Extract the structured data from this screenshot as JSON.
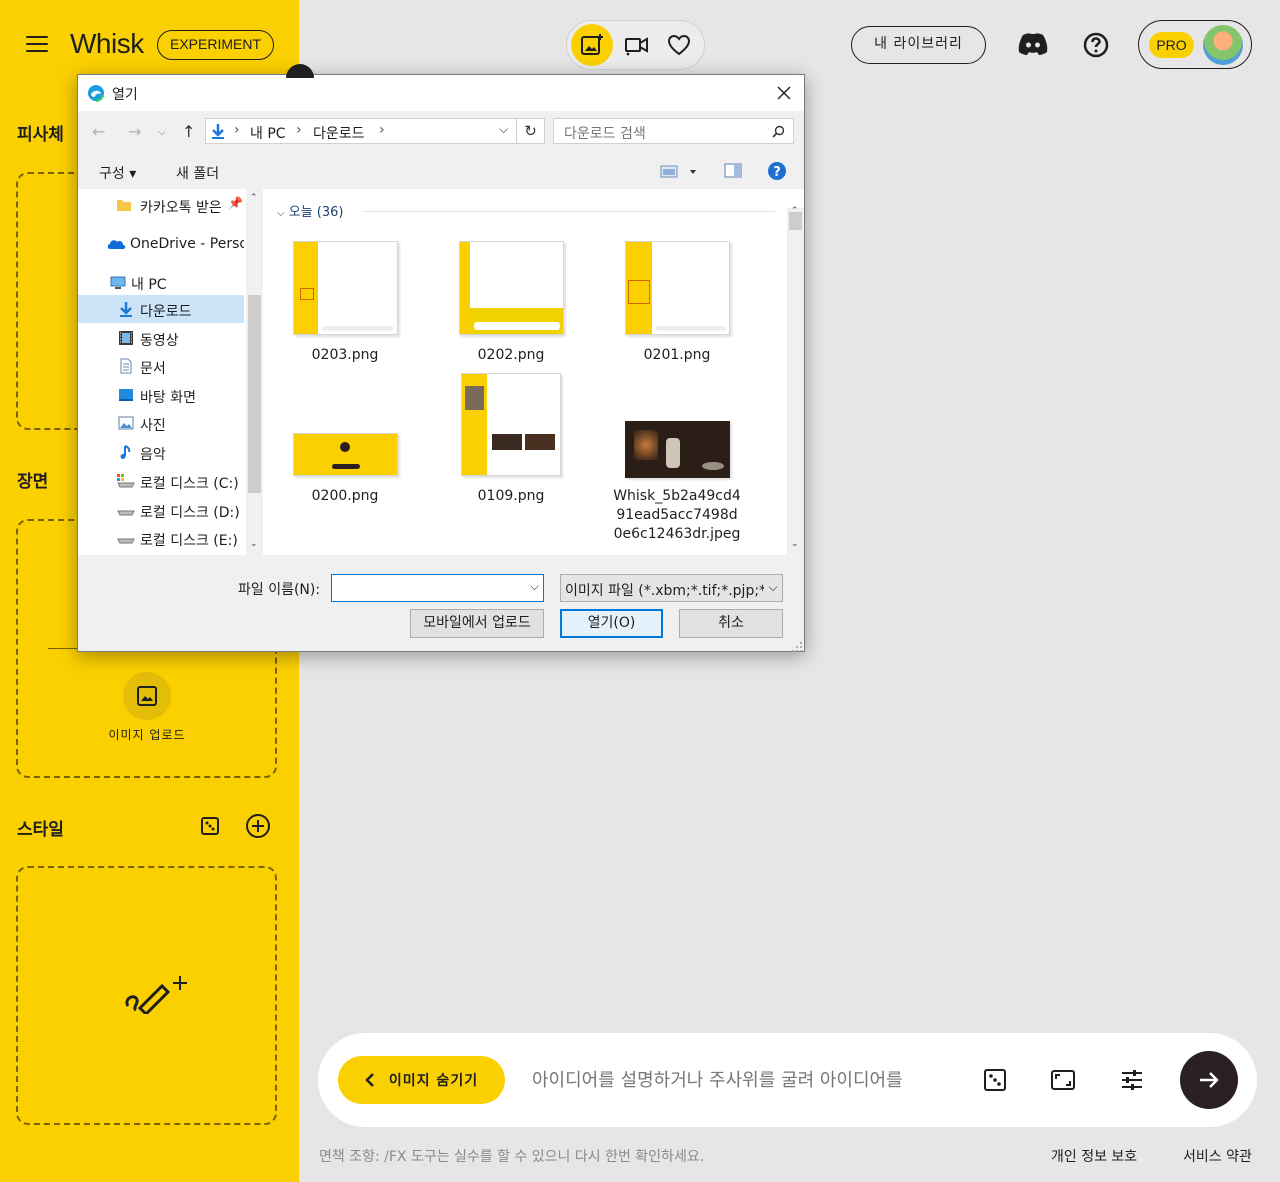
{
  "app": {
    "logo": "Whisk",
    "experiment_badge": "EXPERIMENT"
  },
  "sidebar": {
    "subject_title": "피사체",
    "scene_title": "장면",
    "style_title": "스타일",
    "upload_label": "이미지 업로드"
  },
  "topbar": {
    "library_label": "내 라이브러리",
    "pro_badge": "PRO"
  },
  "prompt": {
    "hide_images_label": "이미지 숨기기",
    "placeholder": "아이디어를 설명하거나 주사위를 굴려 아이디어를"
  },
  "footer": {
    "disclaimer": "면책 조항: /FX 도구는 실수를 할 수 있으니 다시 한번 확인하세요.",
    "privacy": "개인 정보 보호",
    "terms": "서비스 약관"
  },
  "dialog": {
    "title": "열기",
    "breadcrumb": [
      "내 PC",
      "다운로드"
    ],
    "search_placeholder": "다운로드 검색",
    "toolbar": {
      "organize": "구성",
      "new_folder": "새 폴더"
    },
    "nav_items": [
      {
        "label": "카카오톡 받은",
        "icon": "folder-icon"
      },
      {
        "label": "OneDrive - Personal",
        "icon": "cloud-icon"
      },
      {
        "label": "내 PC",
        "icon": "pc-icon"
      },
      {
        "label": "다운로드",
        "icon": "download-icon"
      },
      {
        "label": "동영상",
        "icon": "video-icon"
      },
      {
        "label": "문서",
        "icon": "document-icon"
      },
      {
        "label": "바탕 화면",
        "icon": "desktop-icon"
      },
      {
        "label": "사진",
        "icon": "picture-icon"
      },
      {
        "label": "음악",
        "icon": "music-icon"
      },
      {
        "label": "로컬 디스크 (C:)",
        "icon": "drive-icon"
      },
      {
        "label": "로컬 디스크 (D:)",
        "icon": "drive-icon"
      },
      {
        "label": "로컬 디스크 (E:)",
        "icon": "drive-icon"
      }
    ],
    "group_header": "오늘 (36)",
    "files": [
      {
        "name": "0203.png"
      },
      {
        "name": "0202.png"
      },
      {
        "name": "0201.png"
      },
      {
        "name": "0200.png"
      },
      {
        "name": "0109.png"
      },
      {
        "name": "Whisk_5b2a49cd491ead5acc7498d0e6c12463dr.jpeg"
      }
    ],
    "file_name_label": "파일 이름(N):",
    "file_name_value": "",
    "file_type": "이미지 파일 (*.xbm;*.tif;*.pjp;*.a",
    "mobile_upload_label": "모바일에서 업로드",
    "open_label": "열기(O)",
    "cancel_label": "취소"
  },
  "colors": {
    "accent_yellow": "#fbd000",
    "dark": "#2a2022",
    "background": "#e6e6e6",
    "dialog_focus_blue": "#0078d7"
  }
}
